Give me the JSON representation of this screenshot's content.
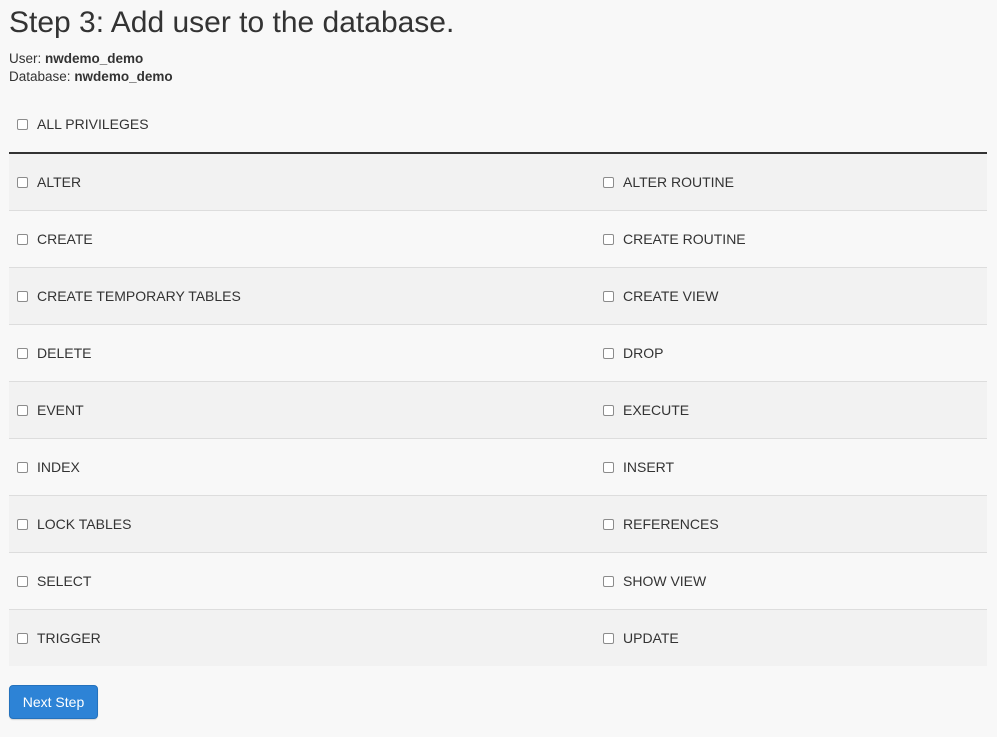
{
  "heading": "Step 3: Add user to the database.",
  "user": {
    "label": "User:",
    "value": "nwdemo_demo"
  },
  "database": {
    "label": "Database:",
    "value": "nwdemo_demo"
  },
  "all_privileges": {
    "label": "ALL PRIVILEGES",
    "checked": false
  },
  "privileges": [
    {
      "left": "ALTER",
      "right": "ALTER ROUTINE"
    },
    {
      "left": "CREATE",
      "right": "CREATE ROUTINE"
    },
    {
      "left": "CREATE TEMPORARY TABLES",
      "right": "CREATE VIEW"
    },
    {
      "left": "DELETE",
      "right": "DROP"
    },
    {
      "left": "EVENT",
      "right": "EXECUTE"
    },
    {
      "left": "INDEX",
      "right": "INSERT"
    },
    {
      "left": "LOCK TABLES",
      "right": "REFERENCES"
    },
    {
      "left": "SELECT",
      "right": "SHOW VIEW"
    },
    {
      "left": "TRIGGER",
      "right": "UPDATE"
    }
  ],
  "next_button": {
    "label": "Next Step",
    "color": "#2d83d6"
  }
}
